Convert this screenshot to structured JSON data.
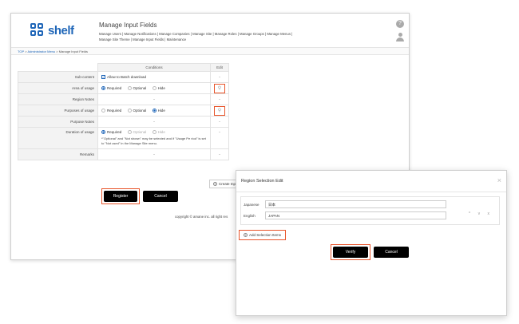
{
  "header": {
    "logo_text": "shelf",
    "title": "Manage Input Fields",
    "nav_items": [
      "Manage Users",
      "Manage Notifications",
      "Manage Companies",
      "Manage Site",
      "Manage Roles",
      "Manage Groups",
      "Manage Menus",
      "Manage Site Theme",
      "Manage Input Fields",
      "Maintenance"
    ],
    "help_glyph": "?"
  },
  "breadcrumb": {
    "top": "TOP",
    "admin": "Administrator Menu",
    "current": "Manage Input Fields",
    "sep": ">"
  },
  "table": {
    "col_conditions": "Conditions",
    "col_edit": "Edit",
    "rows": {
      "subcontent": {
        "label": "Sub-content",
        "check_label": "Allow to Batch download",
        "edit": "-"
      },
      "area": {
        "label": "Area of usage",
        "opt1": "Required",
        "opt2": "Optional",
        "opt3": "Hide",
        "edit_icon": "link-icon"
      },
      "region_notes": {
        "label": "Region Notes",
        "value": "-",
        "edit": "-"
      },
      "purposes": {
        "label": "Purposes of usage",
        "opt1": "Required",
        "opt2": "Optional",
        "opt3": "Hide",
        "edit_icon": "link-icon"
      },
      "purpose_notes": {
        "label": "Purpose Notes",
        "value": "-",
        "edit": "-"
      },
      "duration": {
        "label": "Duration of usage",
        "opt1": "Required",
        "opt2": "Optional",
        "opt3": "Hide",
        "note": "*\"Optional\" and \"Not shown\" may be selected and if \"Usage Pe riod\" is set to \"Not used\" in the Manage Site menu.",
        "edit": "-"
      },
      "remarks": {
        "label": "Remarks",
        "value": "-",
        "edit": "-"
      }
    }
  },
  "create_label": "Create Inpu",
  "buttons": {
    "register": "Register",
    "cancel": "Cancel"
  },
  "copyright": "copyright © amane inc. all right res",
  "modal": {
    "title": "Region Selection Edit",
    "close": "×",
    "japanese_label": "Japanese",
    "japanese_value": "日本",
    "english_label": "English",
    "english_value": "JAPAN",
    "ctrl_up": "^",
    "ctrl_down": "v",
    "ctrl_delete": "x",
    "add_items": "Add Selection Items",
    "verify": "Verify",
    "cancel": "Cancel"
  },
  "colors": {
    "accent": "#e8552b",
    "brand": "#1f66b8"
  }
}
